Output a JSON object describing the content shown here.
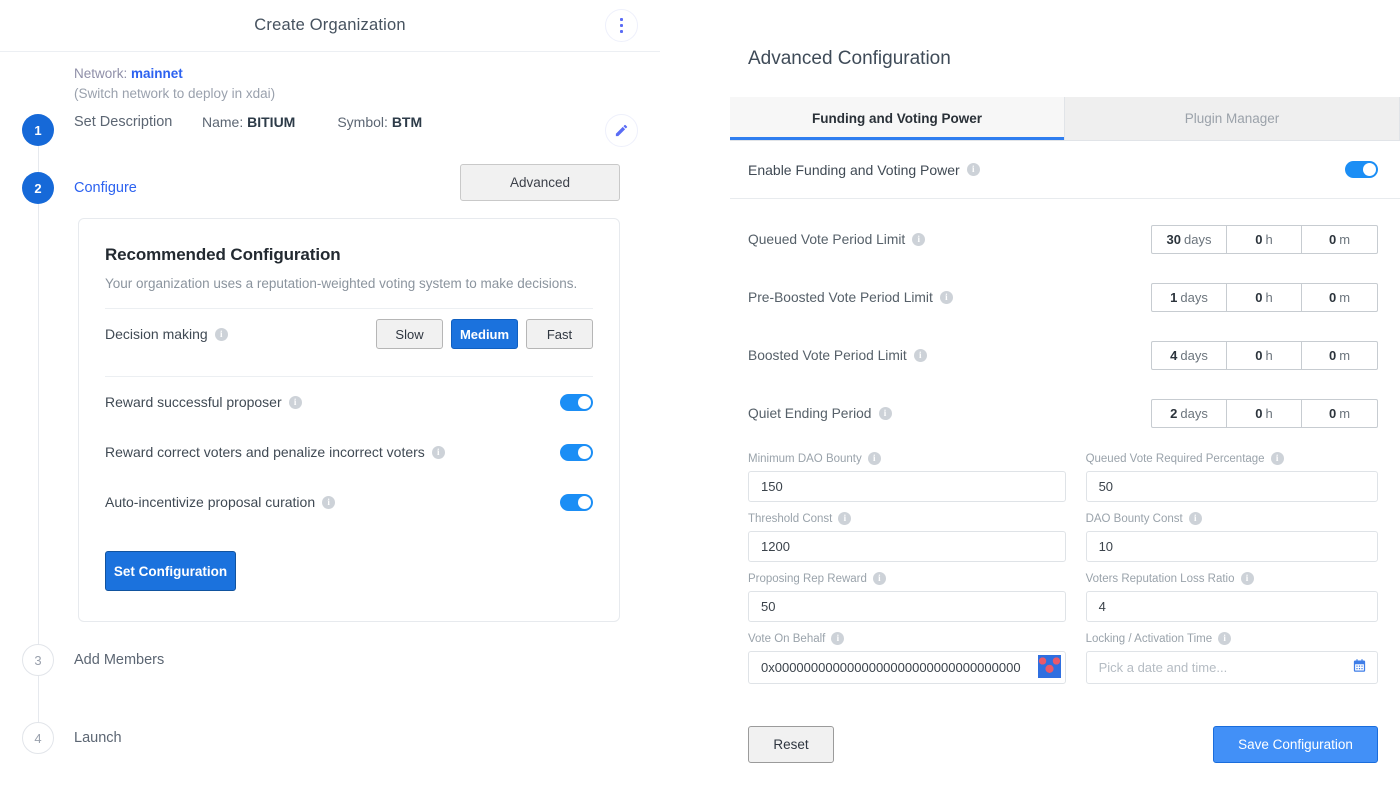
{
  "wizard": {
    "title": "Create Organization",
    "kebab_icon": "more-vertical-icon",
    "network": {
      "label": "Network:",
      "value": "mainnet",
      "switch_note": "(Switch network to deploy in xdai)"
    },
    "steps": [
      {
        "number": "1",
        "label": "Set Description",
        "state": "done",
        "name_label": "Name: ",
        "name_value": "BITIUM",
        "symbol_label": "Symbol: ",
        "symbol_value": "BTM",
        "edit_icon": "pencil-icon"
      },
      {
        "number": "2",
        "label": "Configure",
        "state": "done"
      },
      {
        "number": "3",
        "label": "Add Members",
        "state": "todo"
      },
      {
        "number": "4",
        "label": "Launch",
        "state": "todo"
      }
    ],
    "advanced_button": "Advanced"
  },
  "recommended": {
    "title": "Recommended Configuration",
    "subtitle": "Your organization uses a reputation-weighted voting system to make decisions.",
    "decision_making": {
      "label": "Decision making",
      "info_icon": "info-icon",
      "options": [
        "Slow",
        "Medium",
        "Fast"
      ],
      "selected": "Medium"
    },
    "toggles": [
      {
        "label": "Reward successful proposer",
        "on": true,
        "info_icon": "info-icon"
      },
      {
        "label": "Reward correct voters and penalize incorrect voters",
        "on": true,
        "info_icon": "info-icon"
      },
      {
        "label": "Auto-incentivize proposal curation",
        "on": true,
        "info_icon": "info-icon"
      }
    ],
    "set_config_button": "Set Configuration"
  },
  "advanced": {
    "title": "Advanced Configuration",
    "tabs": [
      {
        "label": "Funding and Voting Power",
        "active": true
      },
      {
        "label": "Plugin Manager",
        "active": false
      }
    ],
    "enable_row": {
      "label": "Enable Funding and Voting Power",
      "on": true,
      "info_icon": "info-icon"
    },
    "periods": [
      {
        "label": "Queued Vote Period Limit",
        "days": "30",
        "days_unit": "days",
        "hours": "0",
        "hours_unit": "h",
        "minutes": "0",
        "minutes_unit": "m"
      },
      {
        "label": "Pre-Boosted Vote Period Limit",
        "days": "1",
        "days_unit": "days",
        "hours": "0",
        "hours_unit": "h",
        "minutes": "0",
        "minutes_unit": "m"
      },
      {
        "label": "Boosted Vote Period Limit",
        "days": "4",
        "days_unit": "days",
        "hours": "0",
        "hours_unit": "h",
        "minutes": "0",
        "minutes_unit": "m"
      },
      {
        "label": "Quiet Ending Period",
        "days": "2",
        "days_unit": "days",
        "hours": "0",
        "hours_unit": "h",
        "minutes": "0",
        "minutes_unit": "m"
      }
    ],
    "fields": [
      {
        "label": "Minimum DAO Bounty",
        "value": "150"
      },
      {
        "label": "Queued Vote Required Percentage",
        "value": "50"
      },
      {
        "label": "Threshold Const",
        "value": "1200"
      },
      {
        "label": "DAO Bounty Const",
        "value": "10"
      },
      {
        "label": "Proposing Rep Reward",
        "value": "50"
      },
      {
        "label": "Voters Reputation Loss Ratio",
        "value": "4"
      }
    ],
    "vote_on_behalf": {
      "label": "Vote On Behalf",
      "value": "0x0000000000000000000000000000000000",
      "identicon": "blockie-identicon"
    },
    "locking_time": {
      "label": "Locking / Activation Time",
      "placeholder": "Pick a date and time...",
      "calendar_icon": "calendar-icon"
    },
    "reset_button": "Reset",
    "save_button": "Save Configuration"
  },
  "colors": {
    "accent_blue": "#2c62f0",
    "button_blue": "#1b72dd",
    "toggle_blue": "#1b8ef5",
    "save_blue": "#4290f7",
    "tab_underline": "#2f7ef0"
  }
}
